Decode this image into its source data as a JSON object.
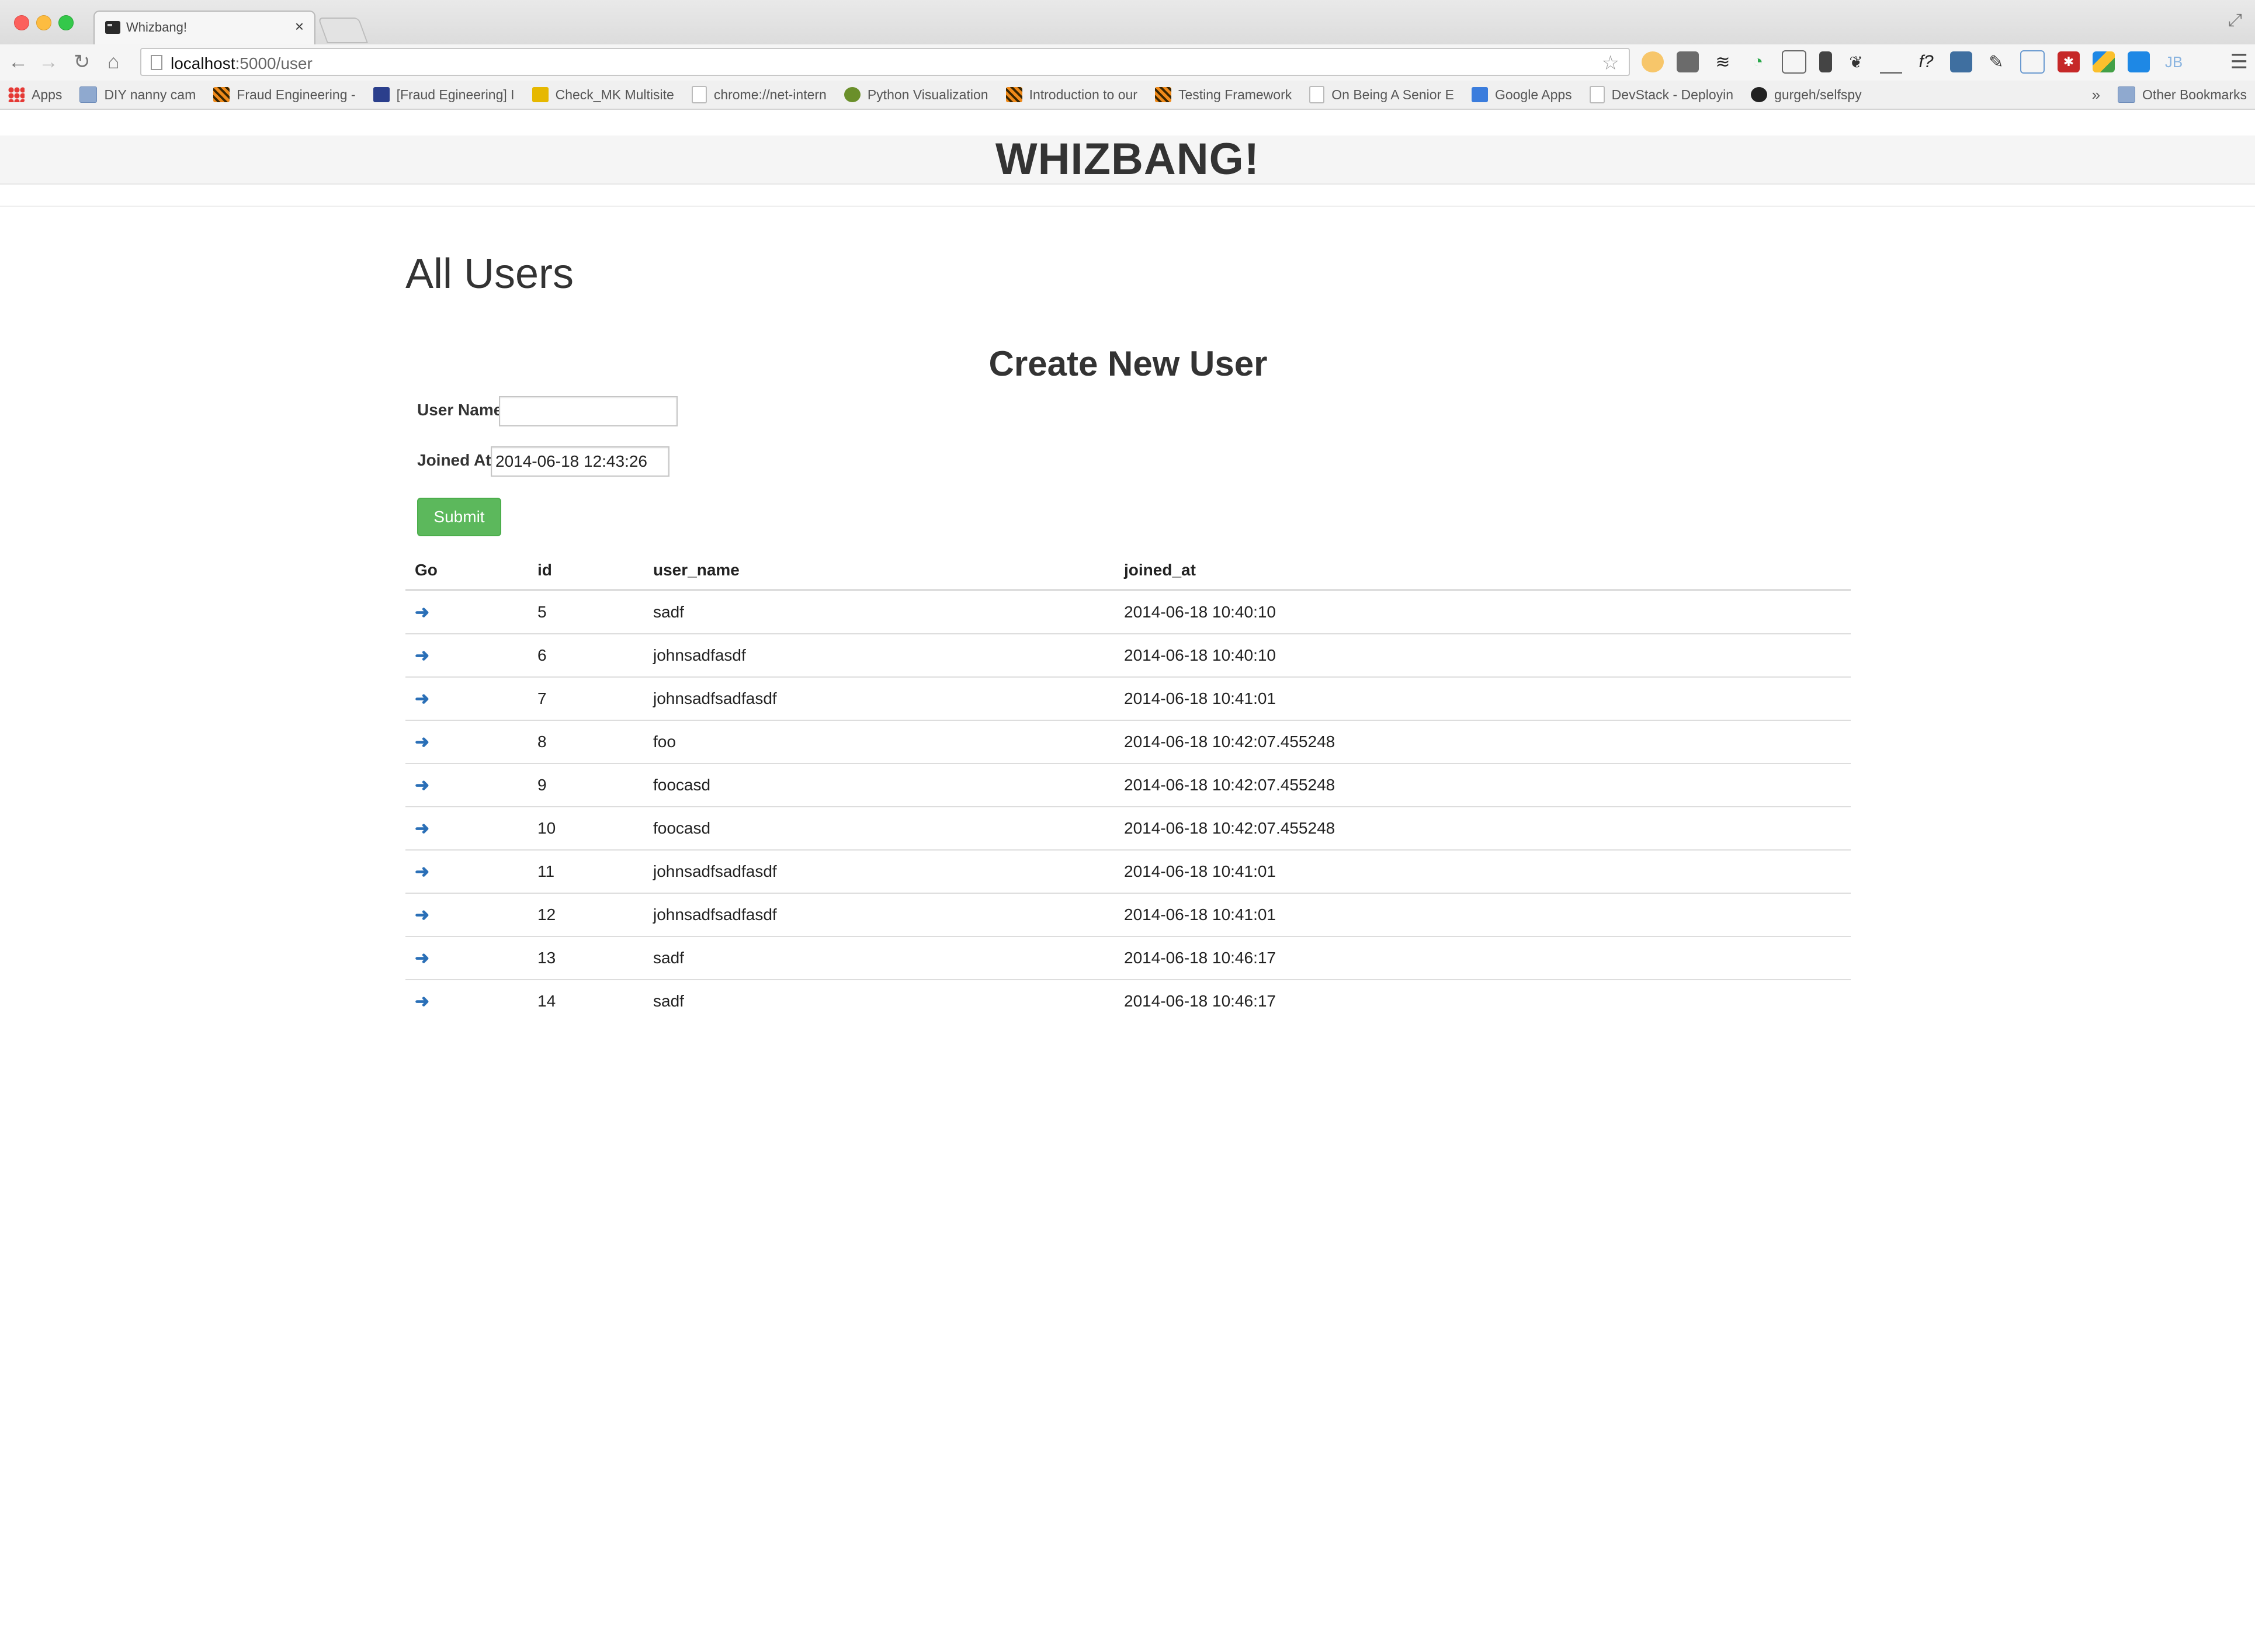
{
  "browser": {
    "tab_title": "Whizbang!",
    "tab_close": "×",
    "url_host": "localhost",
    "url_path": ":5000/user",
    "bookmarks": [
      {
        "label": "Apps",
        "icon": "apps-grid-icon"
      },
      {
        "label": "DIY nanny cam",
        "icon": "folder-icon"
      },
      {
        "label": "Fraud Engineering -",
        "icon": "tiger-icon"
      },
      {
        "label": "[Fraud Egineering] I",
        "icon": "flame-icon"
      },
      {
        "label": "Check_MK Multisite",
        "icon": "checkmk-icon"
      },
      {
        "label": "chrome://net-intern",
        "icon": "page-icon"
      },
      {
        "label": "Python Visualization",
        "icon": "python-icon"
      },
      {
        "label": "Introduction to our",
        "icon": "tiger-icon"
      },
      {
        "label": "Testing Framework",
        "icon": "tiger-icon"
      },
      {
        "label": "On Being A Senior E",
        "icon": "page-icon"
      },
      {
        "label": "Google Apps",
        "icon": "google-icon"
      },
      {
        "label": "DevStack - Deployin",
        "icon": "page-icon"
      },
      {
        "label": "gurgeh/selfspy",
        "icon": "github-icon"
      }
    ],
    "bookmarks_overflow": "»",
    "other_bookmarks": "Other Bookmarks"
  },
  "site": {
    "brand": "WHIZBANG!"
  },
  "page": {
    "title": "All Users",
    "form": {
      "title": "Create New User",
      "user_name_label": "User Name",
      "user_name_value": "",
      "joined_at_label": "Joined At",
      "joined_at_value": "2014-06-18 12:43:26",
      "submit_label": "Submit"
    },
    "table": {
      "headers": [
        "Go",
        "id",
        "user_name",
        "joined_at"
      ],
      "rows": [
        {
          "id": "5",
          "user_name": "sadf",
          "joined_at": "2014-06-18 10:40:10"
        },
        {
          "id": "6",
          "user_name": "johnsadfasdf",
          "joined_at": "2014-06-18 10:40:10"
        },
        {
          "id": "7",
          "user_name": "johnsadfsadfasdf",
          "joined_at": "2014-06-18 10:41:01"
        },
        {
          "id": "8",
          "user_name": "foo",
          "joined_at": "2014-06-18 10:42:07.455248"
        },
        {
          "id": "9",
          "user_name": "foocasd",
          "joined_at": "2014-06-18 10:42:07.455248"
        },
        {
          "id": "10",
          "user_name": "foocasd",
          "joined_at": "2014-06-18 10:42:07.455248"
        },
        {
          "id": "11",
          "user_name": "johnsadfsadfasdf",
          "joined_at": "2014-06-18 10:41:01"
        },
        {
          "id": "12",
          "user_name": "johnsadfsadfasdf",
          "joined_at": "2014-06-18 10:41:01"
        },
        {
          "id": "13",
          "user_name": "sadf",
          "joined_at": "2014-06-18 10:46:17"
        },
        {
          "id": "14",
          "user_name": "sadf",
          "joined_at": "2014-06-18 10:46:17"
        }
      ],
      "go_icon": "arrow-right-icon"
    }
  },
  "colors": {
    "submit": "#5cb85c",
    "link": "#2a6fb7"
  }
}
